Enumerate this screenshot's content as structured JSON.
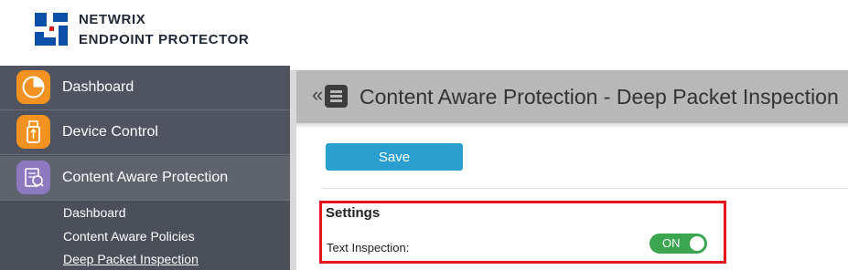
{
  "brand": {
    "line1": "NETWRIX",
    "line2": "ENDPOINT PROTECTOR"
  },
  "sidebar": {
    "items": [
      {
        "label": "Dashboard",
        "icon": "dashboard-pie-icon",
        "color": "#f39221"
      },
      {
        "label": "Device Control",
        "icon": "usb-icon",
        "color": "#f39221"
      },
      {
        "label": "Content Aware Protection",
        "icon": "document-scan-icon",
        "color": "#8c79c0"
      }
    ],
    "subitems": [
      {
        "label": "Dashboard"
      },
      {
        "label": "Content Aware Policies"
      },
      {
        "label": "Deep Packet Inspection"
      }
    ]
  },
  "page": {
    "collapse_glyph": "«",
    "title": "Content Aware Protection - Deep Packet Inspection"
  },
  "actions": {
    "save_label": "Save"
  },
  "settings": {
    "title": "Settings",
    "text_inspection_label": "Text Inspection:",
    "text_inspection_state": "ON"
  },
  "colors": {
    "accent": "#2a9fcf",
    "toggle_on": "#3ba550",
    "highlight": "#e8141b",
    "sidebar": "#4b4f5a"
  }
}
